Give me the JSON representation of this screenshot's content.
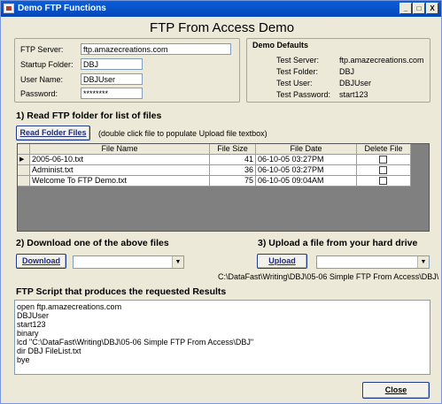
{
  "window": {
    "title": "Demo FTP Functions",
    "minimize_glyph": "_",
    "maximize_glyph": "□",
    "close_glyph": "X"
  },
  "form_title": "FTP From Access Demo",
  "connection": {
    "server_label": "FTP Server:",
    "server_value": "ftp.amazecreations.com",
    "folder_label": "Startup Folder:",
    "folder_value": "DBJ",
    "user_label": "User Name:",
    "user_value": "DBJUser",
    "password_label": "Password:",
    "password_value": "********"
  },
  "defaults": {
    "heading": "Demo Defaults",
    "server_label": "Test Server:",
    "server_value": "ftp.amazecreations.com",
    "folder_label": "Test Folder:",
    "folder_value": "DBJ",
    "user_label": "Test User:",
    "user_value": "DBJUser",
    "password_label": "Test Password:",
    "password_value": "start123"
  },
  "section1": {
    "heading": "1)  Read FTP folder for list of files",
    "button_label": "Read Folder Files",
    "hint": "(double click file to populate Upload file textbox)"
  },
  "file_table": {
    "columns": [
      "File Name",
      "File Size",
      "File Date",
      "Delete File"
    ],
    "rows": [
      {
        "name": "2005-06-10.txt",
        "size": "41",
        "date": "06-10-05  03:27PM",
        "delete": false,
        "selector": "▶"
      },
      {
        "name": "Administ.txt",
        "size": "36",
        "date": "06-10-05  03:27PM",
        "delete": false,
        "selector": ""
      },
      {
        "name": "Welcome To FTP Demo.txt",
        "size": "75",
        "date": "06-10-05  09:04AM",
        "delete": false,
        "selector": ""
      }
    ]
  },
  "section2": {
    "heading": "2)  Download one of the above files",
    "button_label": "Download",
    "combo_value": "",
    "arrow_glyph": "▼"
  },
  "section3": {
    "heading": "3)  Upload a file from your hard drive",
    "button_label": "Upload",
    "combo_value": "",
    "arrow_glyph": "▼",
    "path": "C:\\DataFast\\Writing\\DBJ\\05-06 Simple FTP From Access\\DBJ\\"
  },
  "script_section": {
    "heading": "FTP Script that produces the requested Results",
    "lines": [
      "open ftp.amazecreations.com",
      "DBJUser",
      "start123",
      "binary",
      "lcd \"C:\\DataFast\\Writing\\DBJ\\05-06 Simple FTP From Access\\DBJ\"",
      "dir DBJ FileList.txt",
      "bye"
    ]
  },
  "close_button_label": "Close"
}
